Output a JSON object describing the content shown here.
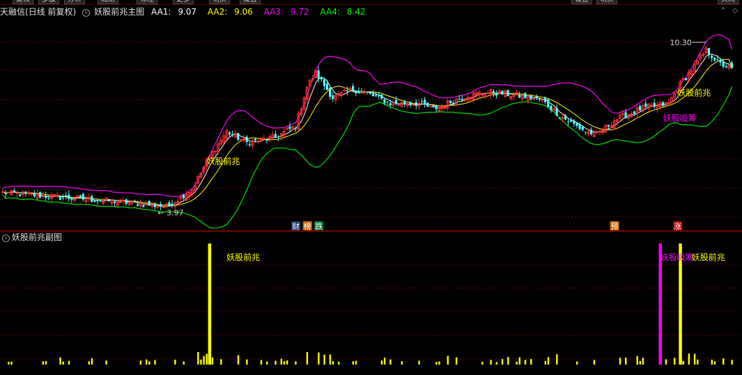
{
  "topbar": {
    "buttons": [
      "复权",
      "多股",
      "分析",
      "周期",
      "标注",
      "更多",
      "切换",
      "设置",
      "设置",
      "切换"
    ],
    "close_label": "关闭"
  },
  "main_panel": {
    "stock_name": "天融信",
    "mode": "(日线 前复权)",
    "indicator_name": "妖股前兆主图",
    "aa": [
      {
        "label": "AA1:",
        "value": "9.07",
        "color": "#ffffff"
      },
      {
        "label": "AA2:",
        "value": "9.06",
        "color": "#ffff00"
      },
      {
        "label": "AA3:",
        "value": "9.72",
        "color": "#ff00ff"
      },
      {
        "label": "AA4:",
        "value": "8.42",
        "color": "#00ff00"
      }
    ],
    "markers": {
      "high": "10.30",
      "low": "3.97"
    },
    "signal_labels": [
      {
        "text": "妖股前兆",
        "index": 71,
        "color": "#ffff00"
      },
      {
        "text": "妖股前兆",
        "index": 235,
        "color": "#ffff00"
      },
      {
        "text": "妖股吸筹",
        "index": 230,
        "color": "#ff00ff"
      }
    ],
    "event_tags": [
      {
        "text": "财",
        "index": 102,
        "bg": "#1a3a6a",
        "fg": "#ffffff"
      },
      {
        "text": "榜",
        "index": 106,
        "bg": "#c86400",
        "fg": "#ffffff"
      },
      {
        "text": "跌",
        "index": 110,
        "bg": "#007a32",
        "fg": "#ffffff"
      },
      {
        "text": "预",
        "index": 213,
        "bg": "#c86400",
        "fg": "#ffffff"
      },
      {
        "text": "涨",
        "index": 235,
        "bg": "#b40000",
        "fg": "#ffffff"
      }
    ]
  },
  "sub_panel": {
    "indicator_name": "妖股前兆副图",
    "labels": [
      {
        "text": "妖股前兆",
        "index": 76,
        "color": "#ffff00"
      },
      {
        "text": "妖股吸筹",
        "index": 229,
        "color": "#ff00ff"
      },
      {
        "text": "妖股前兆",
        "index": 240,
        "color": "#ffff00"
      }
    ]
  },
  "colors": {
    "up": "#ff3232",
    "down": "#54ffff",
    "ma_white": "#ffffff",
    "ma_yellow": "#ffff00",
    "band_upper": "#ff00ff",
    "band_lower": "#00e000",
    "grid": "#7a0000"
  },
  "chart_data": {
    "type": "candlestick",
    "count": 255,
    "price_range": [
      3.6,
      10.8
    ],
    "close_anchors": [
      [
        0,
        4.62
      ],
      [
        20,
        4.45
      ],
      [
        40,
        4.3
      ],
      [
        57,
        4.12
      ],
      [
        60,
        4.32
      ],
      [
        66,
        4.75
      ],
      [
        72,
        5.9
      ],
      [
        78,
        6.8
      ],
      [
        85,
        6.4
      ],
      [
        95,
        6.6
      ],
      [
        102,
        7.0
      ],
      [
        106,
        8.4
      ],
      [
        109,
        8.9
      ],
      [
        115,
        8.0
      ],
      [
        122,
        8.3
      ],
      [
        126,
        8.2
      ],
      [
        135,
        7.8
      ],
      [
        145,
        7.8
      ],
      [
        150,
        7.6
      ],
      [
        162,
        8.1
      ],
      [
        170,
        8.2
      ],
      [
        178,
        8.1
      ],
      [
        184,
        8.0
      ],
      [
        188,
        7.9
      ],
      [
        195,
        7.3
      ],
      [
        203,
        6.8
      ],
      [
        207,
        6.7
      ],
      [
        213,
        7.2
      ],
      [
        222,
        7.6
      ],
      [
        232,
        7.8
      ],
      [
        236,
        8.5
      ],
      [
        240,
        9.0
      ],
      [
        245,
        9.7
      ],
      [
        250,
        9.2
      ],
      [
        254,
        9.07
      ]
    ],
    "ma_white_last": 9.07,
    "ma_yellow_last": 9.06,
    "band_upper_last": 9.72,
    "band_lower_last": 8.42,
    "sub_bars": [
      {
        "index": 72,
        "value": 100,
        "color": "#ffff00"
      },
      {
        "index": 229,
        "value": 100,
        "color": "#ff00ff"
      },
      {
        "index": 236,
        "value": 100,
        "color": "#ffff00"
      }
    ]
  }
}
